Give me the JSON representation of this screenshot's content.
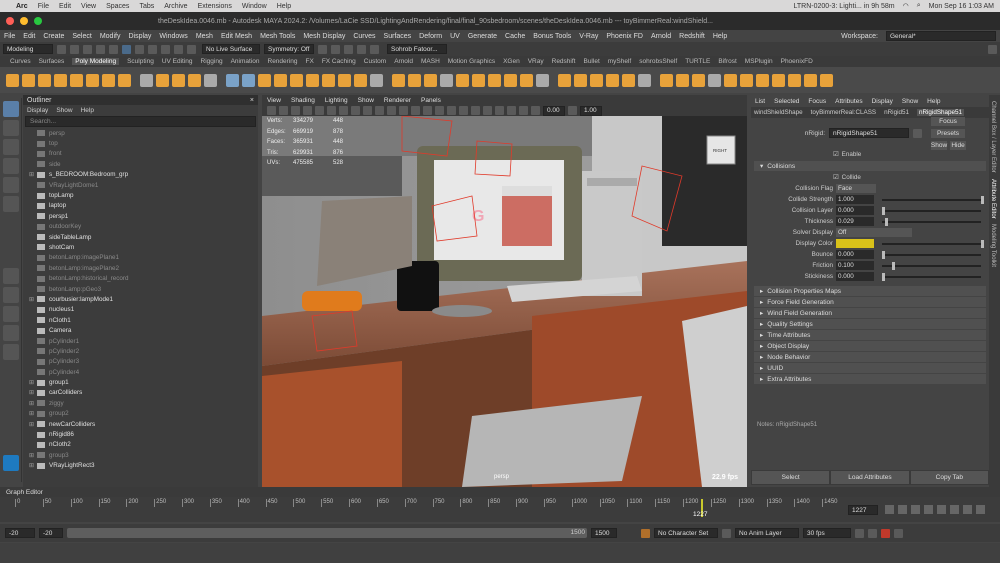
{
  "macbar": {
    "apple": "",
    "items": [
      "Arc",
      "File",
      "Edit",
      "View",
      "Spaces",
      "Tabs",
      "Archive",
      "Extensions",
      "Window",
      "Help"
    ],
    "ltrn": "LTRN-0200-3: Lighti... in 9h 58m",
    "clock": "Mon Sep 16  1:03 AM"
  },
  "titlebar": {
    "title": "theDeskIdea.0046.mb - Autodesk MAYA 2024.2: /Volumes/LaCie SSD/LightingAndRendering/final/final_90sbedroom/scenes/theDeskIdea.0046.mb  ---  toyBimmerReal:windShield..."
  },
  "maya_menu": [
    "File",
    "Edit",
    "Create",
    "Select",
    "Modify",
    "Display",
    "Windows",
    "Mesh",
    "Edit Mesh",
    "Mesh Tools",
    "Mesh Display",
    "Curves",
    "Surfaces",
    "Deform",
    "UV",
    "Generate",
    "Cache",
    "Bonus Tools",
    "V-Ray",
    "Phoenix FD",
    "Arnold",
    "Redshift",
    "Help"
  ],
  "workspace": {
    "label": "Workspace:",
    "value": "General*"
  },
  "status": {
    "mode": "Modeling",
    "live": "No Live Surface",
    "symmetry": "Symmetry: Off",
    "user": "Sohrob Fatoor..."
  },
  "shelf_tabs": [
    "Curves",
    "Surfaces",
    "Poly Modeling",
    "Sculpting",
    "UV Editing",
    "Rigging",
    "Animation",
    "Rendering",
    "FX",
    "FX Caching",
    "Custom",
    "Arnold",
    "MASH",
    "Motion Graphics",
    "XGen",
    "VRay",
    "Redshift",
    "Bullet",
    "myShelf",
    "sohrobsShelf",
    "TURTLE",
    "Bifrost",
    "MSPlugin",
    "PhoenixFD"
  ],
  "shelf_active": "Poly Modeling",
  "outliner": {
    "title": "Outliner",
    "menu": [
      "Display",
      "Show",
      "Help"
    ],
    "search": "Search...",
    "items": [
      {
        "label": "persp",
        "dim": true,
        "exp": false
      },
      {
        "label": "top",
        "dim": true,
        "exp": false
      },
      {
        "label": "front",
        "dim": true,
        "exp": false
      },
      {
        "label": "side",
        "dim": true,
        "exp": false
      },
      {
        "label": "s_BEDROOM:Bedroom_grp",
        "dim": false,
        "exp": true
      },
      {
        "label": "VRayLightDome1",
        "dim": true,
        "exp": false
      },
      {
        "label": "topLamp",
        "dim": false,
        "exp": false
      },
      {
        "label": "laptop",
        "dim": false,
        "exp": false
      },
      {
        "label": "persp1",
        "dim": false,
        "exp": false
      },
      {
        "label": "outdoorKey",
        "dim": true,
        "exp": false
      },
      {
        "label": "sideTableLamp",
        "dim": false,
        "exp": false
      },
      {
        "label": "shotCam",
        "dim": false,
        "exp": false
      },
      {
        "label": "betonLamp:imagePlane1",
        "dim": true,
        "exp": false
      },
      {
        "label": "betonLamp:imagePlane2",
        "dim": true,
        "exp": false
      },
      {
        "label": "betonLamp:historical_record",
        "dim": true,
        "exp": false
      },
      {
        "label": "betonLamp:pGeo3",
        "dim": true,
        "exp": false
      },
      {
        "label": "courbusier:lampMode1",
        "dim": false,
        "exp": true
      },
      {
        "label": "nucleus1",
        "dim": false,
        "exp": false
      },
      {
        "label": "nCloth1",
        "dim": false,
        "exp": false
      },
      {
        "label": "Camera",
        "dim": false,
        "exp": false
      },
      {
        "label": "pCylinder1",
        "dim": true,
        "exp": false
      },
      {
        "label": "pCylinder2",
        "dim": true,
        "exp": false
      },
      {
        "label": "pCylinder3",
        "dim": true,
        "exp": false
      },
      {
        "label": "pCylinder4",
        "dim": true,
        "exp": false
      },
      {
        "label": "group1",
        "dim": false,
        "exp": true
      },
      {
        "label": "carColliders",
        "dim": false,
        "exp": true
      },
      {
        "label": "ziggy",
        "dim": true,
        "exp": true
      },
      {
        "label": "group2",
        "dim": true,
        "exp": true
      },
      {
        "label": "newCarColliders",
        "dim": false,
        "exp": true
      },
      {
        "label": "nRigid86",
        "dim": false,
        "exp": false
      },
      {
        "label": "nCloth2",
        "dim": false,
        "exp": false
      },
      {
        "label": "group3",
        "dim": true,
        "exp": true
      },
      {
        "label": "VRayLightRect3",
        "dim": false,
        "exp": true
      }
    ]
  },
  "viewport": {
    "menu": [
      "View",
      "Shading",
      "Lighting",
      "Show",
      "Renderer",
      "Panels"
    ],
    "hud": [
      {
        "k": "Verts:",
        "a": "334279",
        "b": "448"
      },
      {
        "k": "Edges:",
        "a": "669919",
        "b": "878"
      },
      {
        "k": "Faces:",
        "a": "365931",
        "b": "448"
      },
      {
        "k": "Tris:",
        "a": "629931",
        "b": "876"
      },
      {
        "k": "UVs:",
        "a": "475585",
        "b": "528"
      }
    ],
    "field1": "0.00",
    "field2": "1.00",
    "camera": "persp",
    "fps": "22.9 fps",
    "cube_label": "RIGHT"
  },
  "ae": {
    "menu": [
      "List",
      "Selected",
      "Focus",
      "Attributes",
      "Display",
      "Show",
      "Help"
    ],
    "tabs": [
      "windShieldShape",
      "toyBimmerReal:CLASS",
      "nRigid51",
      "nRigidShape51"
    ],
    "active_tab": "nRigidShape51",
    "node_label": "nRigid:",
    "node_value": "nRigidShape51",
    "btn_focus": "Focus",
    "btn_presets": "Presets",
    "btn_show": "Show",
    "btn_hide": "Hide",
    "enable": "Enable",
    "collisions": "Collisions",
    "collide": "Collide",
    "fields": [
      {
        "label": "Collision Flag",
        "value": "Face",
        "kind": "select"
      },
      {
        "label": "Collide Strength",
        "value": "1.000",
        "kind": "slider",
        "level": 1.0
      },
      {
        "label": "Collision Layer",
        "value": "0.000",
        "kind": "slider",
        "level": 0.0
      },
      {
        "label": "Thickness",
        "value": "0.029",
        "kind": "slider",
        "level": 0.03
      },
      {
        "label": "Solver Display",
        "value": "Off",
        "kind": "select"
      },
      {
        "label": "Display Color",
        "value": "",
        "kind": "color",
        "level": 1.0
      },
      {
        "label": "Bounce",
        "value": "0.000",
        "kind": "slider",
        "level": 0.0
      },
      {
        "label": "Friction",
        "value": "0.100",
        "kind": "slider",
        "level": 0.1
      },
      {
        "label": "Stickiness",
        "value": "0.000",
        "kind": "slider",
        "level": 0.0
      }
    ],
    "sections": [
      "Collision Properties Maps",
      "Force Field Generation",
      "Wind Field Generation",
      "Quality Settings",
      "Time Attributes",
      "Object Display",
      "Node Behavior",
      "UUID",
      "Extra Attributes"
    ],
    "notes": "Notes: nRigidShape51",
    "bottom_buttons": [
      "Select",
      "Load Attributes",
      "Copy Tab"
    ],
    "display_color": "#d9c21a"
  },
  "side_tabs": [
    "Channel Box / Layer Editor",
    "Attribute Editor",
    "Modeling Toolkit"
  ],
  "graph_editor": "Graph Editor",
  "timeline": {
    "ticks": [
      "0",
      "50",
      "100",
      "150",
      "200",
      "250",
      "300",
      "350",
      "400",
      "450",
      "500",
      "550",
      "600",
      "650",
      "700",
      "750",
      "800",
      "850",
      "900",
      "950",
      "1000",
      "1050",
      "1100",
      "1150",
      "1200",
      "1250",
      "1300",
      "1350",
      "1400",
      "1450"
    ],
    "current": "1227",
    "frame_field": "1227"
  },
  "range": {
    "start": "-20",
    "start2": "-20",
    "end": "1500",
    "end2": "1500",
    "charset": "No Character Set",
    "animlayer": "No Anim Layer",
    "fps": "30 fps"
  },
  "cmd": {
    "label": "MEL"
  }
}
